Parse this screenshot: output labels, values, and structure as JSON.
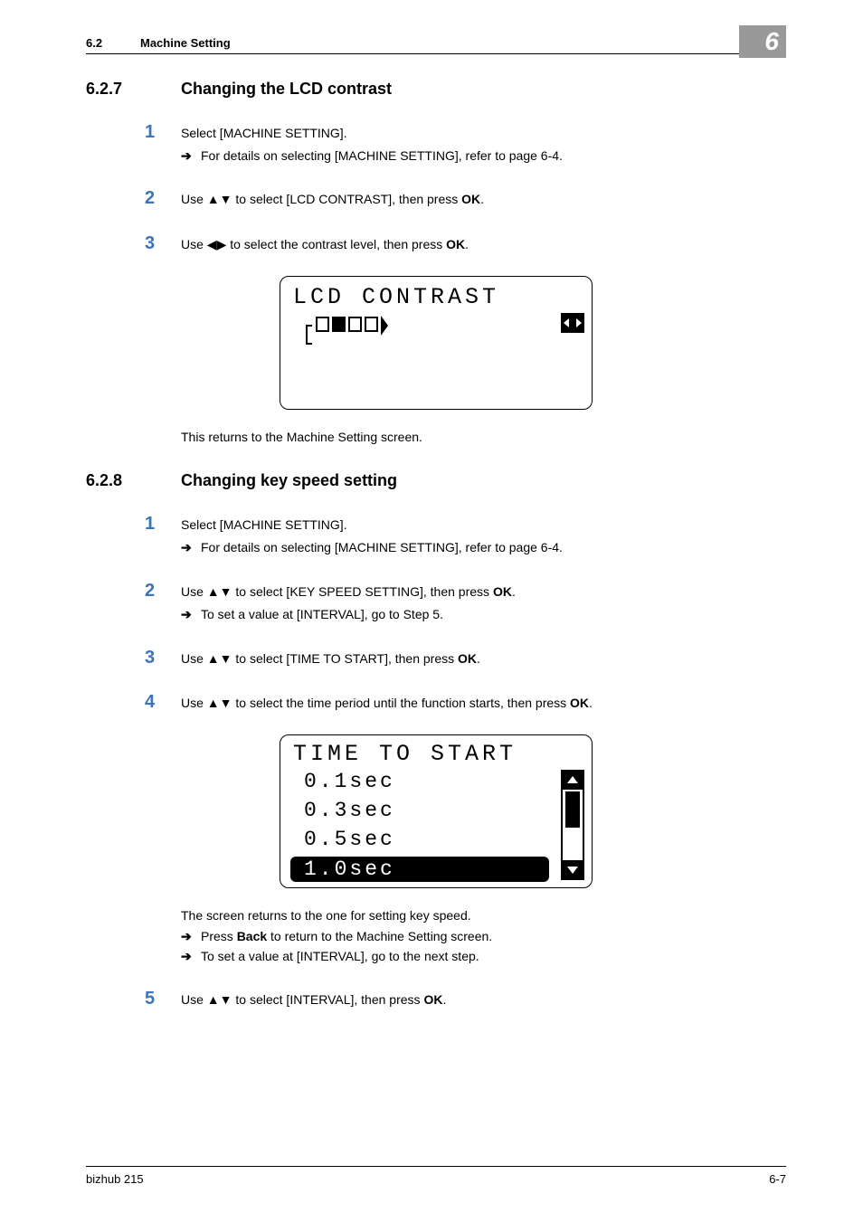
{
  "header": {
    "section_num": "6.2",
    "section_title": "Machine Setting",
    "chapter": "6"
  },
  "s627": {
    "num": "6.2.7",
    "title": "Changing the LCD contrast",
    "steps": {
      "s1": {
        "num": "1",
        "text": "Select [MACHINE SETTING].",
        "sub": "For details on selecting [MACHINE SETTING], refer to page 6-4."
      },
      "s2": {
        "num": "2",
        "pre": "Use ",
        "mid": " to select [LCD CONTRAST], then press ",
        "ok": "OK",
        "post": "."
      },
      "s3": {
        "num": "3",
        "pre": "Use ",
        "mid": " to select the contrast level, then press ",
        "ok": "OK",
        "post": "."
      }
    },
    "lcd_title": "LCD CONTRAST",
    "after": "This returns to the Machine Setting screen."
  },
  "s628": {
    "num": "6.2.8",
    "title": "Changing key speed setting",
    "steps": {
      "s1": {
        "num": "1",
        "text": "Select [MACHINE SETTING].",
        "sub": "For details on selecting [MACHINE SETTING], refer to page 6-4."
      },
      "s2": {
        "num": "2",
        "pre": "Use ",
        "mid": " to select [KEY SPEED SETTING], then press ",
        "ok": "OK",
        "post": ".",
        "sub": "To set a value at [INTERVAL], go to Step 5."
      },
      "s3": {
        "num": "3",
        "pre": "Use ",
        "mid": " to select [TIME TO START], then press ",
        "ok": "OK",
        "post": "."
      },
      "s4": {
        "num": "4",
        "pre": "Use ",
        "mid": " to select the time period until the function starts, then press ",
        "ok": "OK",
        "post": "."
      },
      "s5": {
        "num": "5",
        "pre": "Use ",
        "mid": " to select [INTERVAL], then press ",
        "ok": "OK",
        "post": "."
      }
    },
    "lcd": {
      "title": "TIME TO START",
      "opt1": "0.1sec",
      "opt2": "0.3sec",
      "opt3": "0.5sec",
      "sel": "1.0sec"
    },
    "after": {
      "line": "The screen returns to the one for setting key speed.",
      "sub1_pre": "Press ",
      "sub1_bold": "Back",
      "sub1_post": " to return to the Machine Setting screen.",
      "sub2": "To set a value at [INTERVAL], go to the next step."
    }
  },
  "footer": {
    "left": "bizhub 215",
    "right": "6-7"
  },
  "glyphs": {
    "arrow": "➔"
  }
}
